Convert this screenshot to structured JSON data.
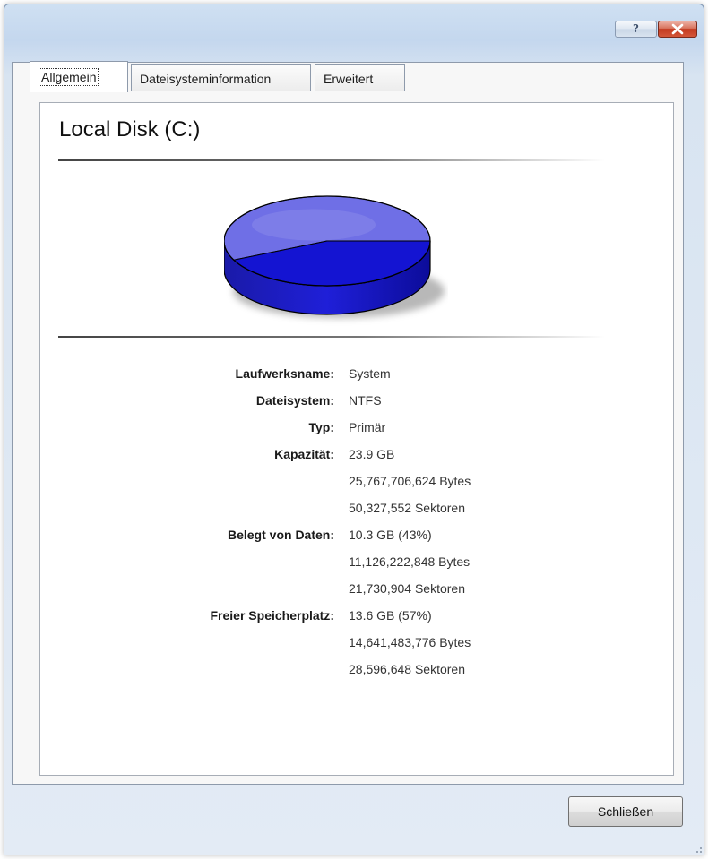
{
  "window": {
    "help_label": "?",
    "colors": {
      "used": "#1414d2",
      "free": "#6f6fe6",
      "accent": "#c3391f"
    }
  },
  "tabs": [
    {
      "label": "Allgemein",
      "active": true
    },
    {
      "label": "Dateisysteminformation",
      "active": false
    },
    {
      "label": "Erweitert",
      "active": false
    }
  ],
  "drive": {
    "title": "Local Disk (C:)",
    "chart_data": {
      "type": "pie",
      "categories": [
        "Belegt von Daten",
        "Freier Speicherplatz"
      ],
      "values": [
        43,
        57
      ],
      "colors": [
        "#1414d2",
        "#6f6fe6"
      ]
    }
  },
  "info": [
    {
      "label": "Laufwerksname:",
      "values": [
        "System"
      ]
    },
    {
      "label": "Dateisystem:",
      "values": [
        "NTFS"
      ]
    },
    {
      "label": "Typ:",
      "values": [
        "Primär"
      ]
    },
    {
      "label": "Kapazität:",
      "values": [
        "23.9 GB",
        "25,767,706,624 Bytes",
        "50,327,552 Sektoren"
      ]
    },
    {
      "label": "Belegt von Daten:",
      "values": [
        "10.3 GB (43%)",
        "11,126,222,848 Bytes",
        "21,730,904 Sektoren"
      ]
    },
    {
      "label": "Freier Speicherplatz:",
      "values": [
        "13.6 GB (57%)",
        "14,641,483,776 Bytes",
        "28,596,648 Sektoren"
      ]
    }
  ],
  "buttons": {
    "close_label": "Schließen"
  }
}
